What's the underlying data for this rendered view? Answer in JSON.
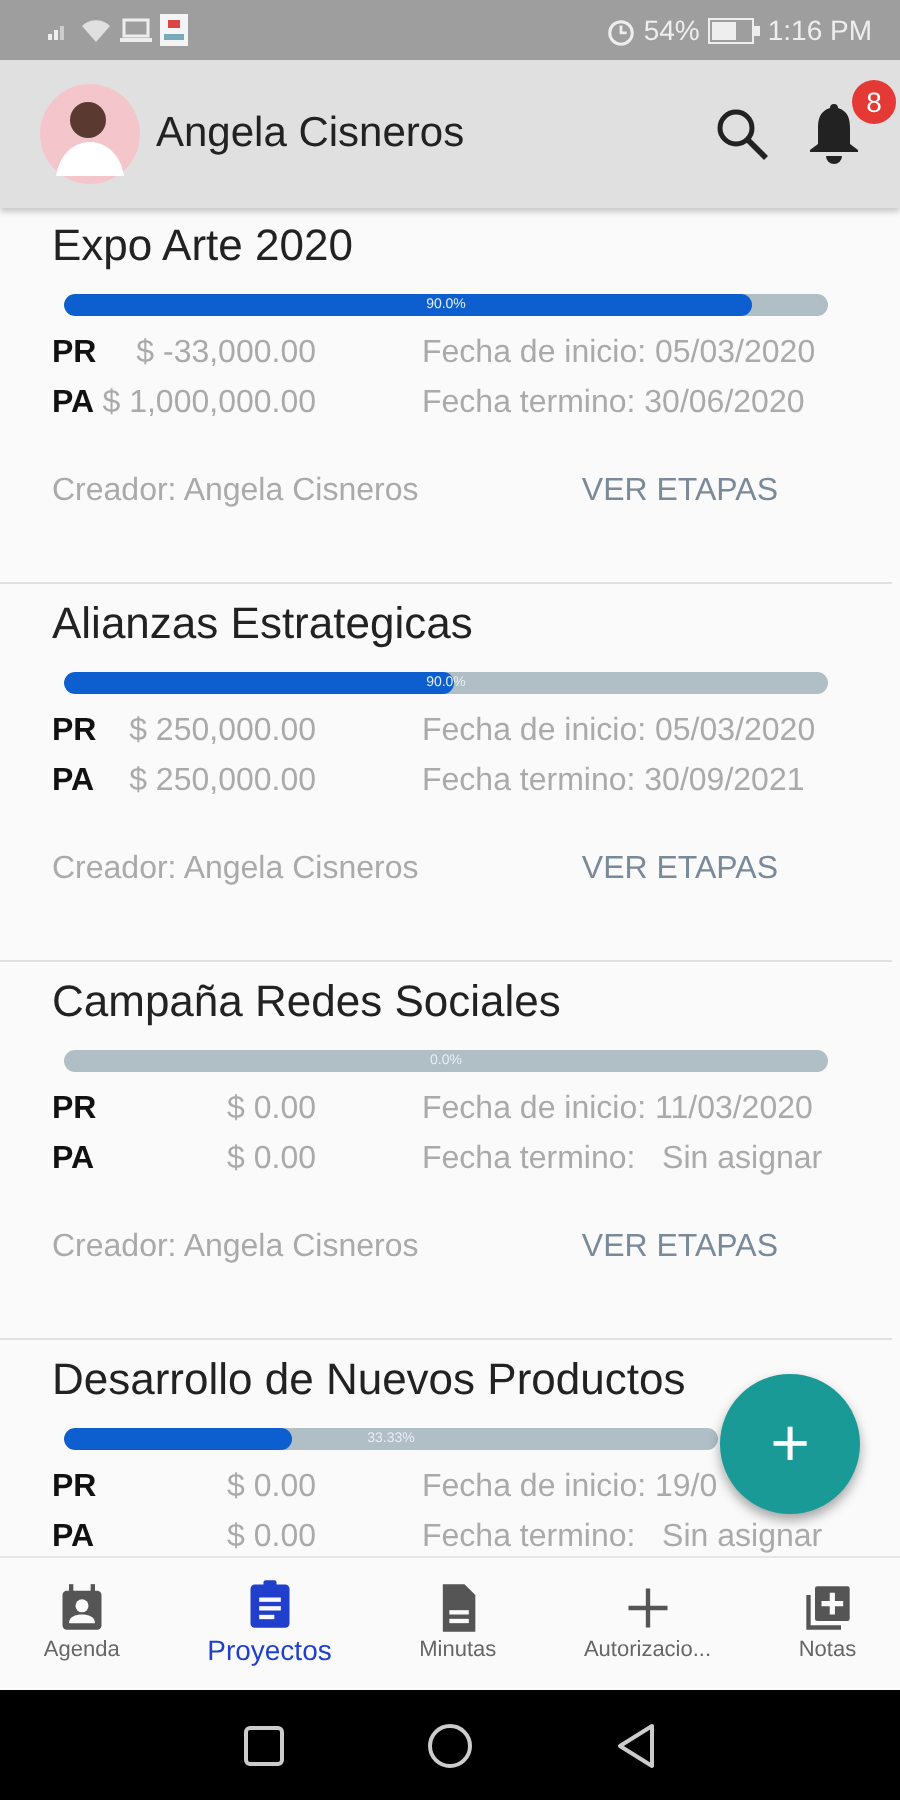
{
  "status_bar": {
    "battery": "54%",
    "time": "1:16 PM"
  },
  "header": {
    "user_name": "Angela Cisneros",
    "notifications": "8"
  },
  "projects": [
    {
      "title": "Expo Arte 2020",
      "level": 0.9,
      "progress_label": "90.0%",
      "pr_label": "PR",
      "pr_amount": "$ -33,000.00",
      "pa_label": "PA",
      "pa_amount": "$ 1,000,000.00",
      "start": "Fecha de inicio: 05/03/2020",
      "end": "Fecha termino: 30/06/2020",
      "creator": "Creador: Angela Cisneros",
      "action": "VER ETAPAS"
    },
    {
      "title": "Alianzas Estrategicas",
      "level": 0.51,
      "progress_label": "90.0%",
      "pr_label": "PR",
      "pr_amount": "$ 250,000.00",
      "pa_label": "PA",
      "pa_amount": "$ 250,000.00",
      "start": "Fecha de inicio: 05/03/2020",
      "end": "Fecha termino: 30/09/2021",
      "creator": "Creador: Angela Cisneros",
      "action": "VER ETAPAS"
    },
    {
      "title": "Campaña Redes Sociales",
      "level": 0,
      "progress_label": "0.0%",
      "pr_label": "PR",
      "pr_amount": "$ 0.00",
      "pa_label": "PA",
      "pa_amount": "$ 0.00",
      "start": "Fecha de inicio: 11/03/2020",
      "end": "Fecha termino:   Sin asignar",
      "creator": "Creador: Angela Cisneros",
      "action": "VER ETAPAS"
    },
    {
      "title": "Desarrollo de Nuevos Productos",
      "level": 0.35,
      "progress_label": "33.33%",
      "pr_label": "PR",
      "pr_amount": "$ 0.00",
      "pa_label": "PA",
      "pa_amount": "$ 0.00",
      "start": "Fecha de inicio: 19/0",
      "end": "Fecha termino:   Sin asignar"
    }
  ],
  "fab": {
    "label": "+"
  },
  "bottom_nav": [
    {
      "label": "Agenda",
      "selected": false
    },
    {
      "label": "Proyectos",
      "selected": true
    },
    {
      "label": "Minutas",
      "selected": false
    },
    {
      "label": "Autorizacio...",
      "selected": false
    },
    {
      "label": "Notas",
      "selected": false
    }
  ]
}
